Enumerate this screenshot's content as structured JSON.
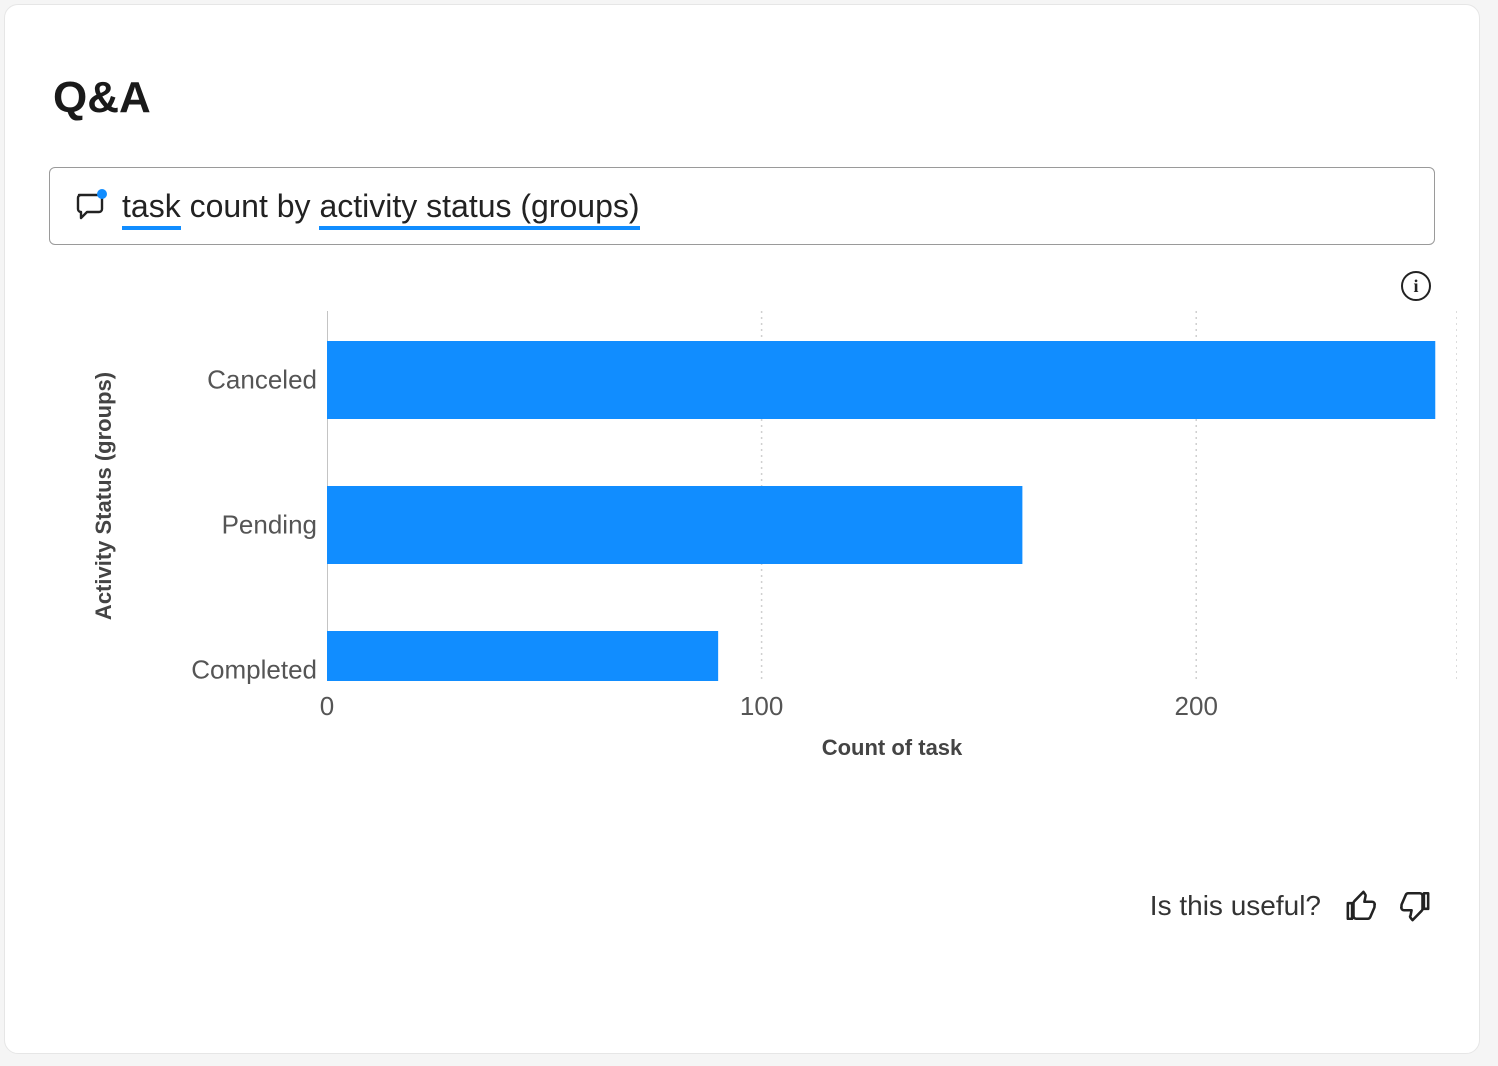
{
  "header": {
    "title": "Q&A"
  },
  "query": {
    "icon_name": "speech-bubble-icon",
    "term1": "task",
    "mid": "count by",
    "term2": "activity status (groups)"
  },
  "toolbar": {
    "info_tooltip": "i"
  },
  "chart_data": {
    "type": "bar",
    "orientation": "horizontal",
    "ylabel": "Activity Status (groups)",
    "xlabel": "Count of task",
    "categories": [
      "Canceled",
      "Pending",
      "Completed"
    ],
    "values": [
      255,
      160,
      90
    ],
    "xlim": [
      0,
      260
    ],
    "xticks": [
      0,
      100,
      200
    ],
    "bar_color": "#118dff",
    "grid": true
  },
  "feedback": {
    "prompt": "Is this useful?"
  }
}
